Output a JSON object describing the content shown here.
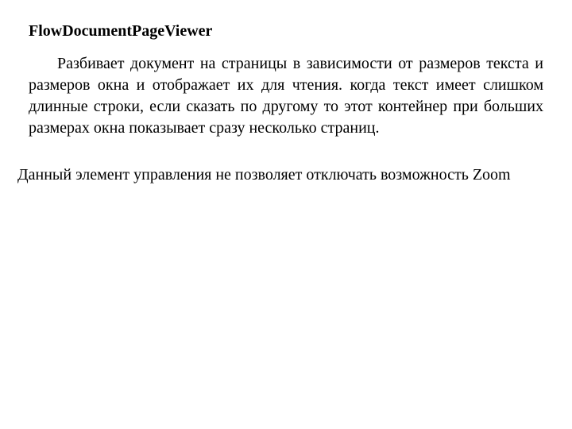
{
  "heading": "FlowDocumentPageViewer",
  "paragraph1": "Разбивает документ на страницы в зависимости от размеров текста и размеров окна и отображает их для чтения. когда текст имеет слишком длинные строки, если сказать по другому то этот контейнер при больших размерах окна показывает сразу несколько страниц.",
  "paragraph2": "Данный элемент управления не позволяет отключать возможность Zoom"
}
